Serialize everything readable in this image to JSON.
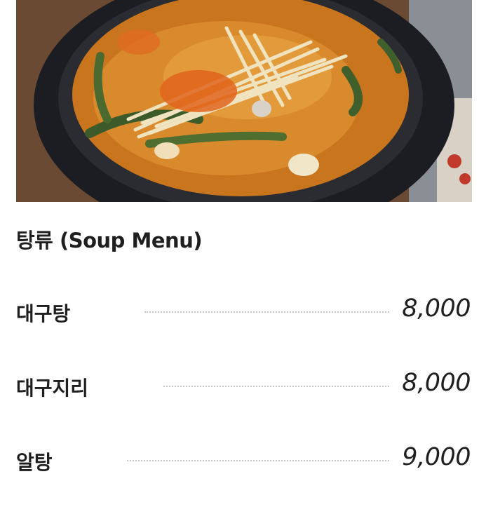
{
  "hero": {
    "image": "soup-photo"
  },
  "section": {
    "title": "탕류 (Soup Menu)"
  },
  "menu": {
    "items": [
      {
        "name": "대구탕",
        "price": "8,000"
      },
      {
        "name": "대구지리",
        "price": "8,000"
      },
      {
        "name": "알탕",
        "price": "9,000"
      }
    ]
  }
}
